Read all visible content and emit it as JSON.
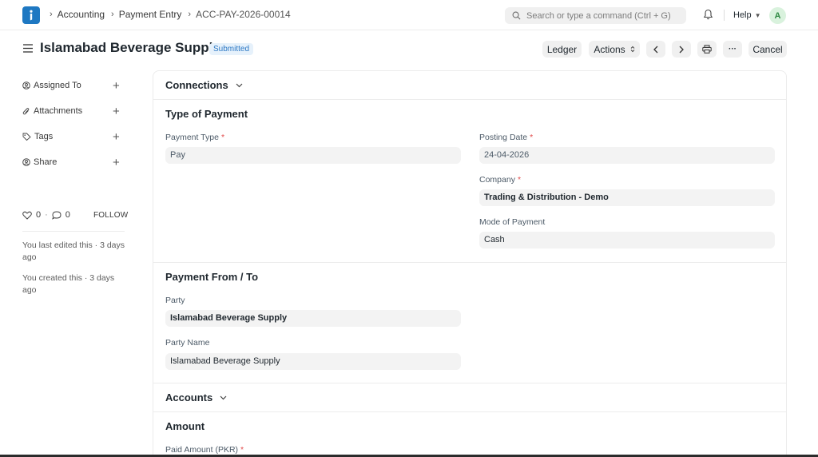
{
  "breadcrumbs": [
    "Accounting",
    "Payment Entry",
    "ACC-PAY-2026-00014"
  ],
  "search": {
    "placeholder": "Search or type a command (Ctrl + G)"
  },
  "navbar": {
    "help_label": "Help",
    "avatar_initial": "A"
  },
  "page": {
    "title": "Islamabad Beverage Supply",
    "status": "Submitted"
  },
  "toolbar": {
    "ledger": "Ledger",
    "actions": "Actions",
    "more": "···",
    "cancel": "Cancel"
  },
  "sidebar": {
    "items": [
      {
        "label": "Assigned To",
        "icon": "user-circle-icon"
      },
      {
        "label": "Attachments",
        "icon": "paperclip-icon"
      },
      {
        "label": "Tags",
        "icon": "tag-icon"
      },
      {
        "label": "Share",
        "icon": "share-icon"
      }
    ],
    "likes": "0",
    "comments": "0",
    "follow": "FOLLOW",
    "activity": [
      "You last edited this · 3 days ago",
      "You created this · 3 days ago"
    ]
  },
  "form": {
    "connections_title": "Connections",
    "type_section_title": "Type of Payment",
    "payment_type_label": "Payment Type",
    "payment_type_value": "Pay",
    "posting_date_label": "Posting Date",
    "posting_date_value": "24-04-2026",
    "company_label": "Company",
    "company_value": "Trading & Distribution - Demo",
    "mode_label": "Mode of Payment",
    "mode_value": "Cash",
    "party_section_title": "Payment From / To",
    "party_label": "Party",
    "party_value": "Islamabad Beverage Supply",
    "party_name_label": "Party Name",
    "party_name_value": "Islamabad Beverage Supply",
    "accounts_title": "Accounts",
    "amount_title": "Amount",
    "paid_amount_label": "Paid Amount (PKR)",
    "required_mark": "*"
  },
  "colors": {
    "brand": "#1e78c2",
    "status_bg": "#e6f1fb",
    "status_text": "#2c78c4",
    "required": "#e24c4c"
  }
}
